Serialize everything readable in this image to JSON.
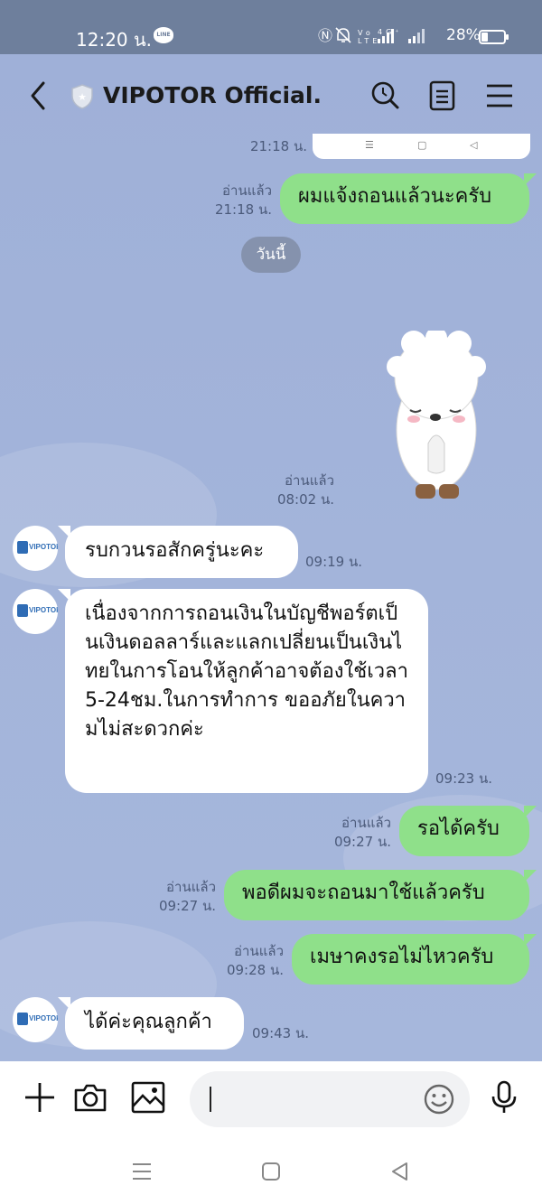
{
  "status_bar": {
    "time": "12:20 น.",
    "app_badge": "LINE",
    "signal_text": "Vo LTE 4G+",
    "battery": "28%"
  },
  "header": {
    "title": "VIPOTOR Official."
  },
  "top_cut": {
    "time": "21:18 น."
  },
  "messages": [
    {
      "side": "me",
      "text": "ผมแจ้งถอนแล้วนะครับ",
      "status": "อ่านแล้ว",
      "time": "21:18 น."
    },
    {
      "side": "me",
      "type": "sticker",
      "status": "อ่านแล้ว",
      "time": "08:02 น."
    },
    {
      "side": "them",
      "text": "รบกวนรอสักครู่นะคะ",
      "time": "09:19 น."
    },
    {
      "side": "them",
      "text": "เนื่องจากการถอนเงินในบัญชีพอร์ตเป็นเงินดอลลาร์และแลกเปลี่ยนเป็นเงินไทยในการโอนให้ลูกค้าอาจต้องใช้เวลา5-24ชม.ในการทำการ ขออภัยในความไม่สะดวกค่ะ",
      "time": "09:23 น."
    },
    {
      "side": "me",
      "text": "รอได้ครับ",
      "status": "อ่านแล้ว",
      "time": "09:27 น."
    },
    {
      "side": "me",
      "text": "พอดีผมจะถอนมาใช้แล้วครับ",
      "status": "อ่านแล้ว",
      "time": "09:27 น."
    },
    {
      "side": "me",
      "text": "เมษาคงรอไม่ไหวครับ",
      "status": "อ่านแล้ว",
      "time": "09:28 น."
    },
    {
      "side": "them",
      "text": "ได้ค่ะคุณลูกค้า",
      "time": "09:43 น."
    }
  ],
  "date_divider": "วันนี้",
  "avatar": {
    "logo_text": "VIPOTOR"
  },
  "input": {
    "placeholder": ""
  },
  "colors": {
    "chat_bg": "#a3b4da",
    "my_bubble": "#8fe08a",
    "their_bubble": "#ffffff",
    "status_bar": "#6e7f9c"
  }
}
